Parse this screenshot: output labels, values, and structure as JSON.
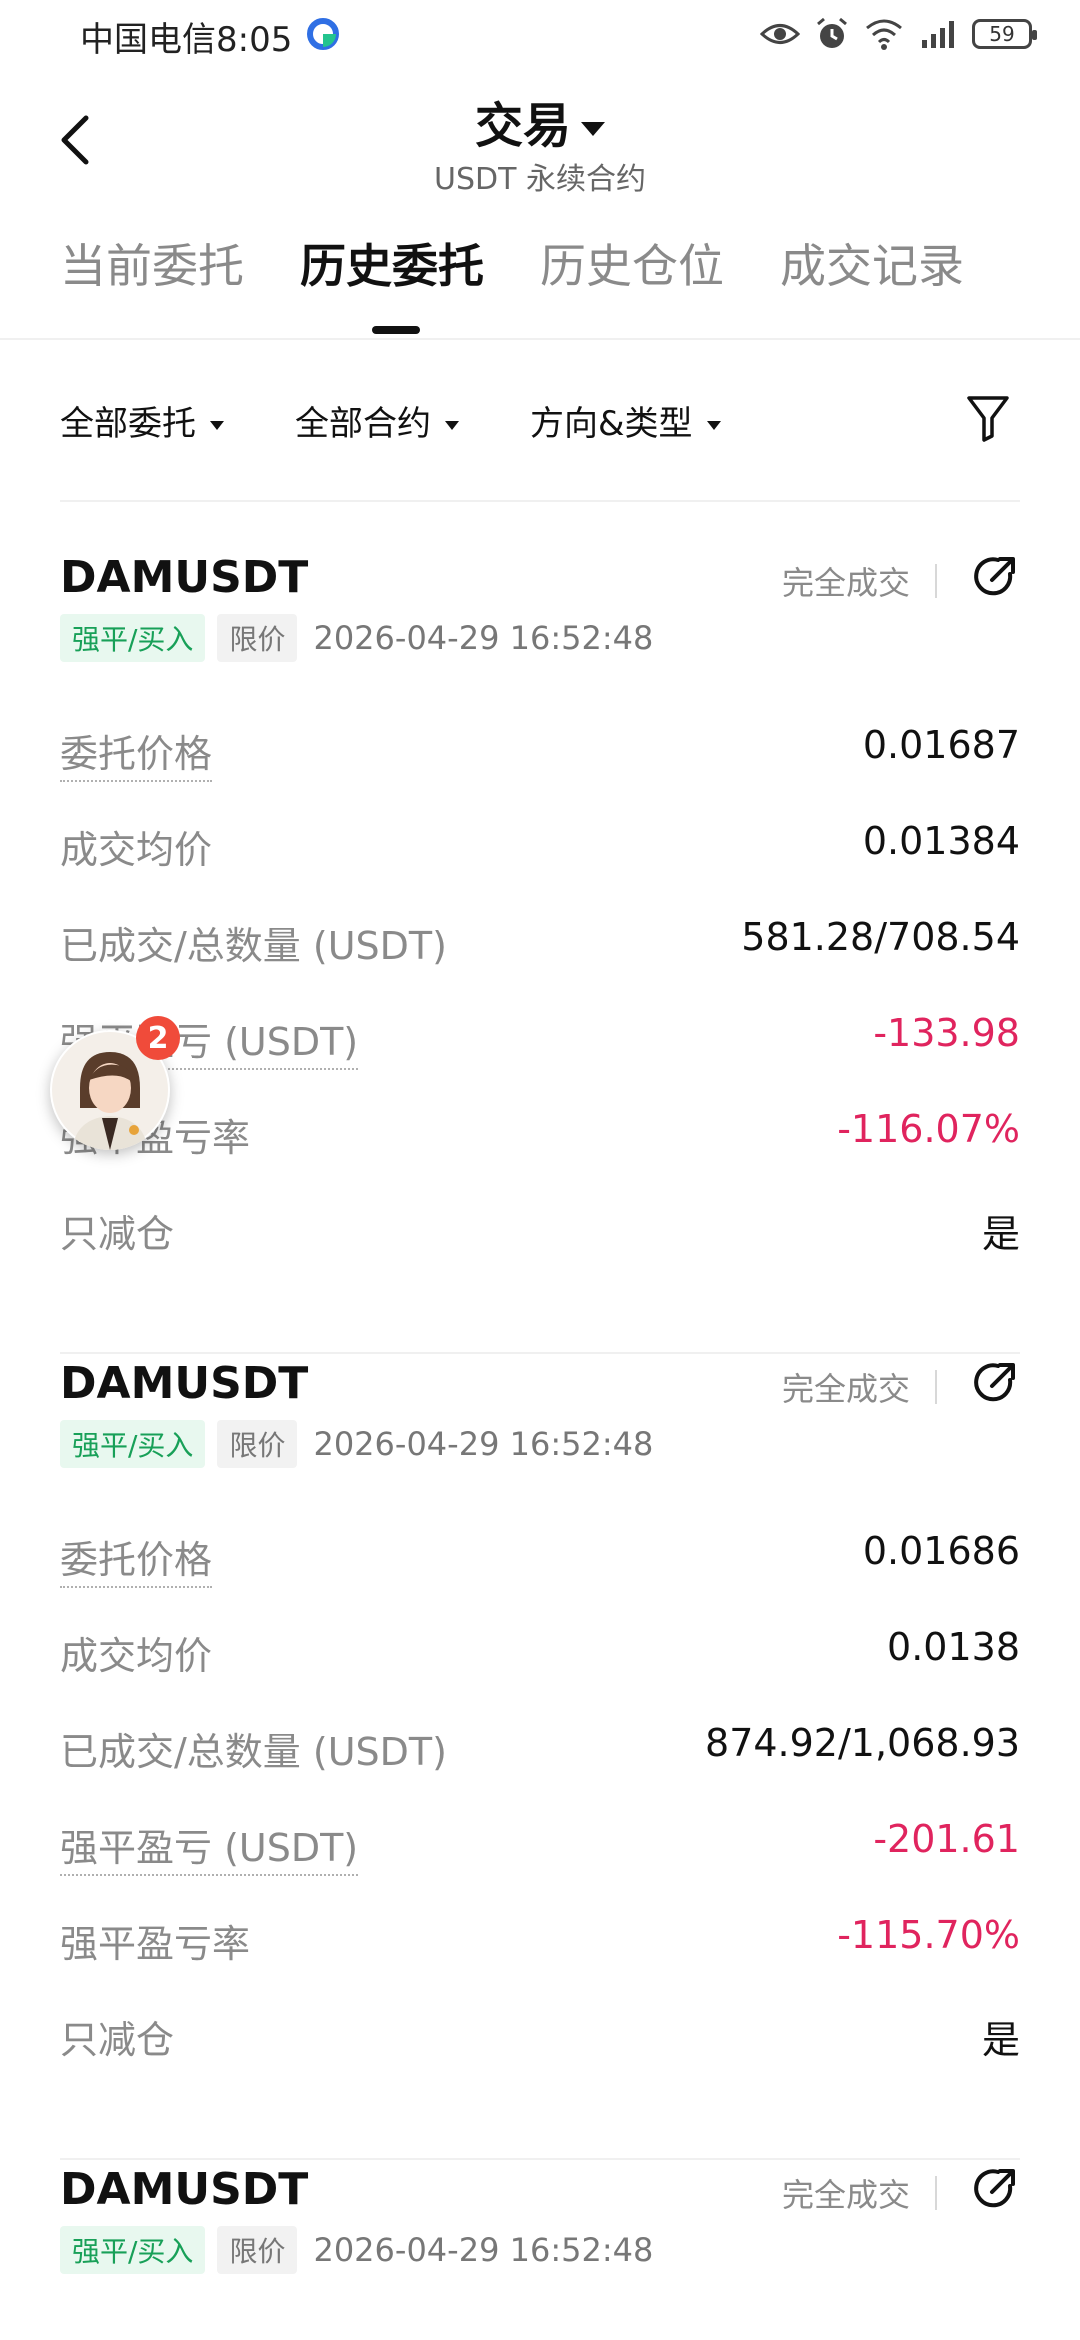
{
  "status_bar": {
    "carrier_time": "中国电信8:05",
    "battery": "59"
  },
  "header": {
    "title": "交易",
    "subtitle": "USDT 永续合约"
  },
  "tabs": [
    {
      "label": "当前委托"
    },
    {
      "label": "历史委托",
      "active": true
    },
    {
      "label": "历史仓位"
    },
    {
      "label": "成交记录"
    }
  ],
  "filters": [
    {
      "label": "全部委托"
    },
    {
      "label": "全部合约"
    },
    {
      "label": "方向&类型"
    }
  ],
  "orders": [
    {
      "symbol": "DAMUSDT",
      "status": "完全成交",
      "side_tag": "强平/买入",
      "type_tag": "限价",
      "time": "2026-04-29 16:52:48",
      "rows": [
        {
          "label": "委托价格",
          "value": "0.01687"
        },
        {
          "label": "成交均价",
          "value": "0.01384"
        },
        {
          "label": "已成交/总数量 (USDT)",
          "value": "581.28/708.54"
        },
        {
          "label": "强平盈亏 (USDT)",
          "value": "-133.98"
        },
        {
          "label": "强平盈亏率",
          "value": "-116.07%"
        },
        {
          "label": "只减仓",
          "value": "是"
        }
      ]
    },
    {
      "symbol": "DAMUSDT",
      "status": "完全成交",
      "side_tag": "强平/买入",
      "type_tag": "限价",
      "time": "2026-04-29 16:52:48",
      "rows": [
        {
          "label": "委托价格",
          "value": "0.01686"
        },
        {
          "label": "成交均价",
          "value": "0.0138"
        },
        {
          "label": "已成交/总数量 (USDT)",
          "value": "874.92/1,068.93"
        },
        {
          "label": "强平盈亏 (USDT)",
          "value": "-201.61"
        },
        {
          "label": "强平盈亏率",
          "value": "-115.70%"
        },
        {
          "label": "只减仓",
          "value": "是"
        }
      ]
    },
    {
      "symbol": "DAMUSDT",
      "status": "完全成交",
      "side_tag": "强平/买入",
      "type_tag": "限价",
      "time": "2026-04-29 16:52:48"
    }
  ],
  "floating_avatar": {
    "badge_count": "2"
  },
  "colors": {
    "negative": "#e0245e",
    "tag_green_text": "#18a058",
    "tag_green_bg": "#e8f8ef"
  }
}
